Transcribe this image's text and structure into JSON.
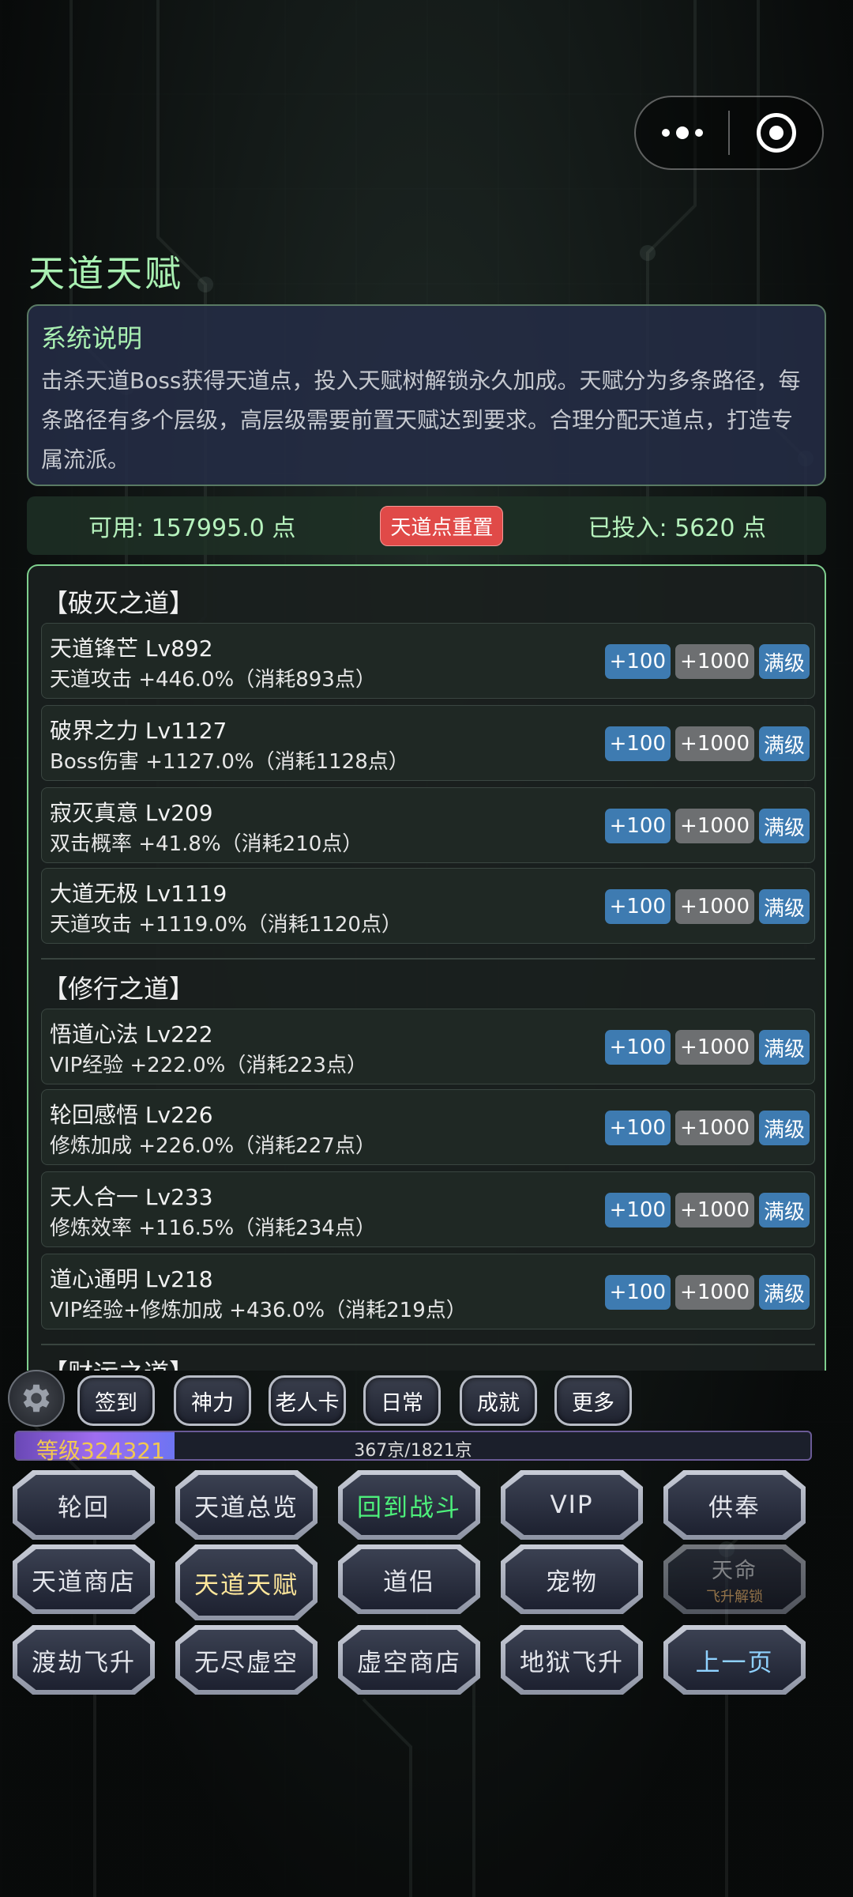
{
  "page": {
    "title": "天道天赋"
  },
  "intro": {
    "heading": "系统说明",
    "text": "击杀天道Boss获得天道点，投入天赋树解锁永久加成。天赋分为多条路径，每条路径有多个层级，高层级需要前置天赋达到要求。合理分配天道点，打造专属流派。"
  },
  "points": {
    "available": "可用: 157995.0 点",
    "reset_label": "天道点重置",
    "invested": "已投入: 5620 点"
  },
  "button_labels": {
    "plus100": "+100",
    "plus1000": "+1000",
    "max": "满级"
  },
  "groups": [
    {
      "title": "【破灭之道】",
      "talents": [
        {
          "name": "天道锋芒 Lv892",
          "desc": "天道攻击 +446.0%（消耗893点）"
        },
        {
          "name": "破界之力 Lv1127",
          "desc": "Boss伤害 +1127.0%（消耗1128点）"
        },
        {
          "name": "寂灭真意 Lv209",
          "desc": "双击概率 +41.8%（消耗210点）"
        },
        {
          "name": "大道无极 Lv1119",
          "desc": "天道攻击 +1119.0%（消耗1120点）"
        }
      ]
    },
    {
      "title": "【修行之道】",
      "talents": [
        {
          "name": "悟道心法 Lv222",
          "desc": "VIP经验 +222.0%（消耗223点）"
        },
        {
          "name": "轮回感悟 Lv226",
          "desc": "修炼加成 +226.0%（消耗227点）"
        },
        {
          "name": "天人合一 Lv233",
          "desc": "修炼效率 +116.5%（消耗234点）"
        },
        {
          "name": "道心通明 Lv218",
          "desc": "VIP经验+修炼加成 +436.0%（消耗219点）"
        }
      ]
    },
    {
      "title": "【财运之道】",
      "talents": []
    }
  ],
  "quick_buttons": [
    "签到",
    "神力",
    "老人卡",
    "日常",
    "成就",
    "更多"
  ],
  "level": {
    "label": "等级324321",
    "exp": "367京/1821京",
    "progress": 0.2
  },
  "menu": {
    "row1": [
      "轮回",
      "天道总览",
      "回到战斗",
      "VIP",
      "供奉"
    ],
    "row2": [
      "天道商店",
      "天道天赋",
      "道侣",
      "宠物",
      "天命"
    ],
    "row2_locked_sub": "飞升解锁",
    "row3": [
      "渡劫飞升",
      "无尽虚空",
      "虚空商店",
      "地狱飞升",
      "上一页"
    ]
  },
  "icons": {
    "menu": "more-dots-icon",
    "close": "target-circle-icon",
    "settings": "gear-icon"
  },
  "colors": {
    "accent_green": "#a9f0b2",
    "reset_red": "#e04a48",
    "button_blue": "#3e7bb1",
    "button_gray": "#6d6f71",
    "level_gold": "#f2c84f"
  }
}
